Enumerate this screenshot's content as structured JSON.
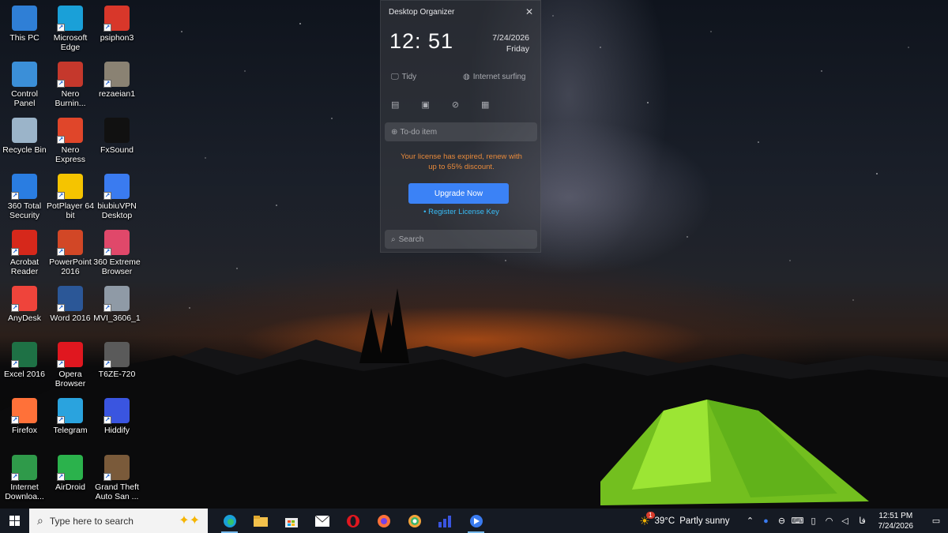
{
  "desktop_icons": [
    {
      "label": "This PC",
      "icon": "computer-icon",
      "color": "#2f7fd6"
    },
    {
      "label": "Microsoft Edge",
      "icon": "edge-icon",
      "color": "#1aa0d8"
    },
    {
      "label": "psiphon3",
      "icon": "psiphon-icon",
      "color": "#d8372a"
    },
    {
      "label": "Control Panel",
      "icon": "control-panel-icon",
      "color": "#3b8fd8"
    },
    {
      "label": "Nero Burnin...",
      "icon": "nero-burning-icon",
      "color": "#c5382c"
    },
    {
      "label": "rezaeian1",
      "icon": "image-file-icon",
      "color": "#8a8273"
    },
    {
      "label": "Recycle Bin",
      "icon": "recycle-bin-icon",
      "color": "#9bb4c9"
    },
    {
      "label": "Nero Express",
      "icon": "nero-express-icon",
      "color": "#e0462a"
    },
    {
      "label": "FxSound",
      "icon": "fxsound-icon",
      "color": "#111111"
    },
    {
      "label": "360 Total Security",
      "icon": "360-security-icon",
      "color": "#2a7de1"
    },
    {
      "label": "PotPlayer 64 bit",
      "icon": "potplayer-icon",
      "color": "#f5c400"
    },
    {
      "label": "biubiuVPN Desktop",
      "icon": "biubiuvpn-icon",
      "color": "#3a7bf0"
    },
    {
      "label": "Acrobat Reader",
      "icon": "acrobat-icon",
      "color": "#d6281b"
    },
    {
      "label": "PowerPoint 2016",
      "icon": "powerpoint-icon",
      "color": "#d24726"
    },
    {
      "label": "360 Extreme Browser",
      "icon": "360-browser-icon",
      "color": "#e0486a"
    },
    {
      "label": "AnyDesk",
      "icon": "anydesk-icon",
      "color": "#ef443b"
    },
    {
      "label": "Word 2016",
      "icon": "word-icon",
      "color": "#2b5797"
    },
    {
      "label": "MVI_3606_1",
      "icon": "video-file-icon",
      "color": "#8f9aa6"
    },
    {
      "label": "Excel 2016",
      "icon": "excel-icon",
      "color": "#1e7145"
    },
    {
      "label": "Opera Browser",
      "icon": "opera-icon",
      "color": "#e0171f"
    },
    {
      "label": "T6ZE-720",
      "icon": "video-thumbnail-icon",
      "color": "#5a5a5a"
    },
    {
      "label": "Firefox",
      "icon": "firefox-icon",
      "color": "#ff7139"
    },
    {
      "label": "Telegram",
      "icon": "telegram-icon",
      "color": "#2aa3de"
    },
    {
      "label": "Hiddify",
      "icon": "hiddify-icon",
      "color": "#3a55e0"
    },
    {
      "label": "Internet Downloa...",
      "icon": "idm-icon",
      "color": "#2f9a4a"
    },
    {
      "label": "AirDroid",
      "icon": "airdroid-icon",
      "color": "#2bb24c"
    },
    {
      "label": "Grand Theft Auto San ...",
      "icon": "gta-icon",
      "color": "#7a5a3a"
    }
  ],
  "widget": {
    "title": "Desktop Organizer",
    "time": "12: 51",
    "date": "7/24/2026",
    "weekday": "Friday",
    "tidy_label": "Tidy",
    "internet_label": "Internet surfing",
    "todo_placeholder": "To-do item",
    "license_line1": "Your license has expired, renew with",
    "license_line2": "up to 65% discount.",
    "upgrade_label": "Upgrade Now",
    "register_label": "• Register License Key",
    "search_placeholder": "Search",
    "accent_color": "#3b82f6",
    "warning_color": "#e88a3b",
    "link_color": "#38bdf8"
  },
  "taskbar": {
    "search_placeholder": "Type here to search",
    "apps": [
      "edge-icon",
      "file-explorer-icon",
      "store-icon",
      "mail-icon",
      "opera-icon",
      "firefox-icon",
      "360-browser-icon",
      "hiddify-icon",
      "biubiu-icon"
    ],
    "weather_badge": "1",
    "weather_temp": "39°C",
    "weather_text": "Partly sunny",
    "language": "فا",
    "clock_time": "12:51 PM",
    "clock_date": "7/24/2026"
  }
}
